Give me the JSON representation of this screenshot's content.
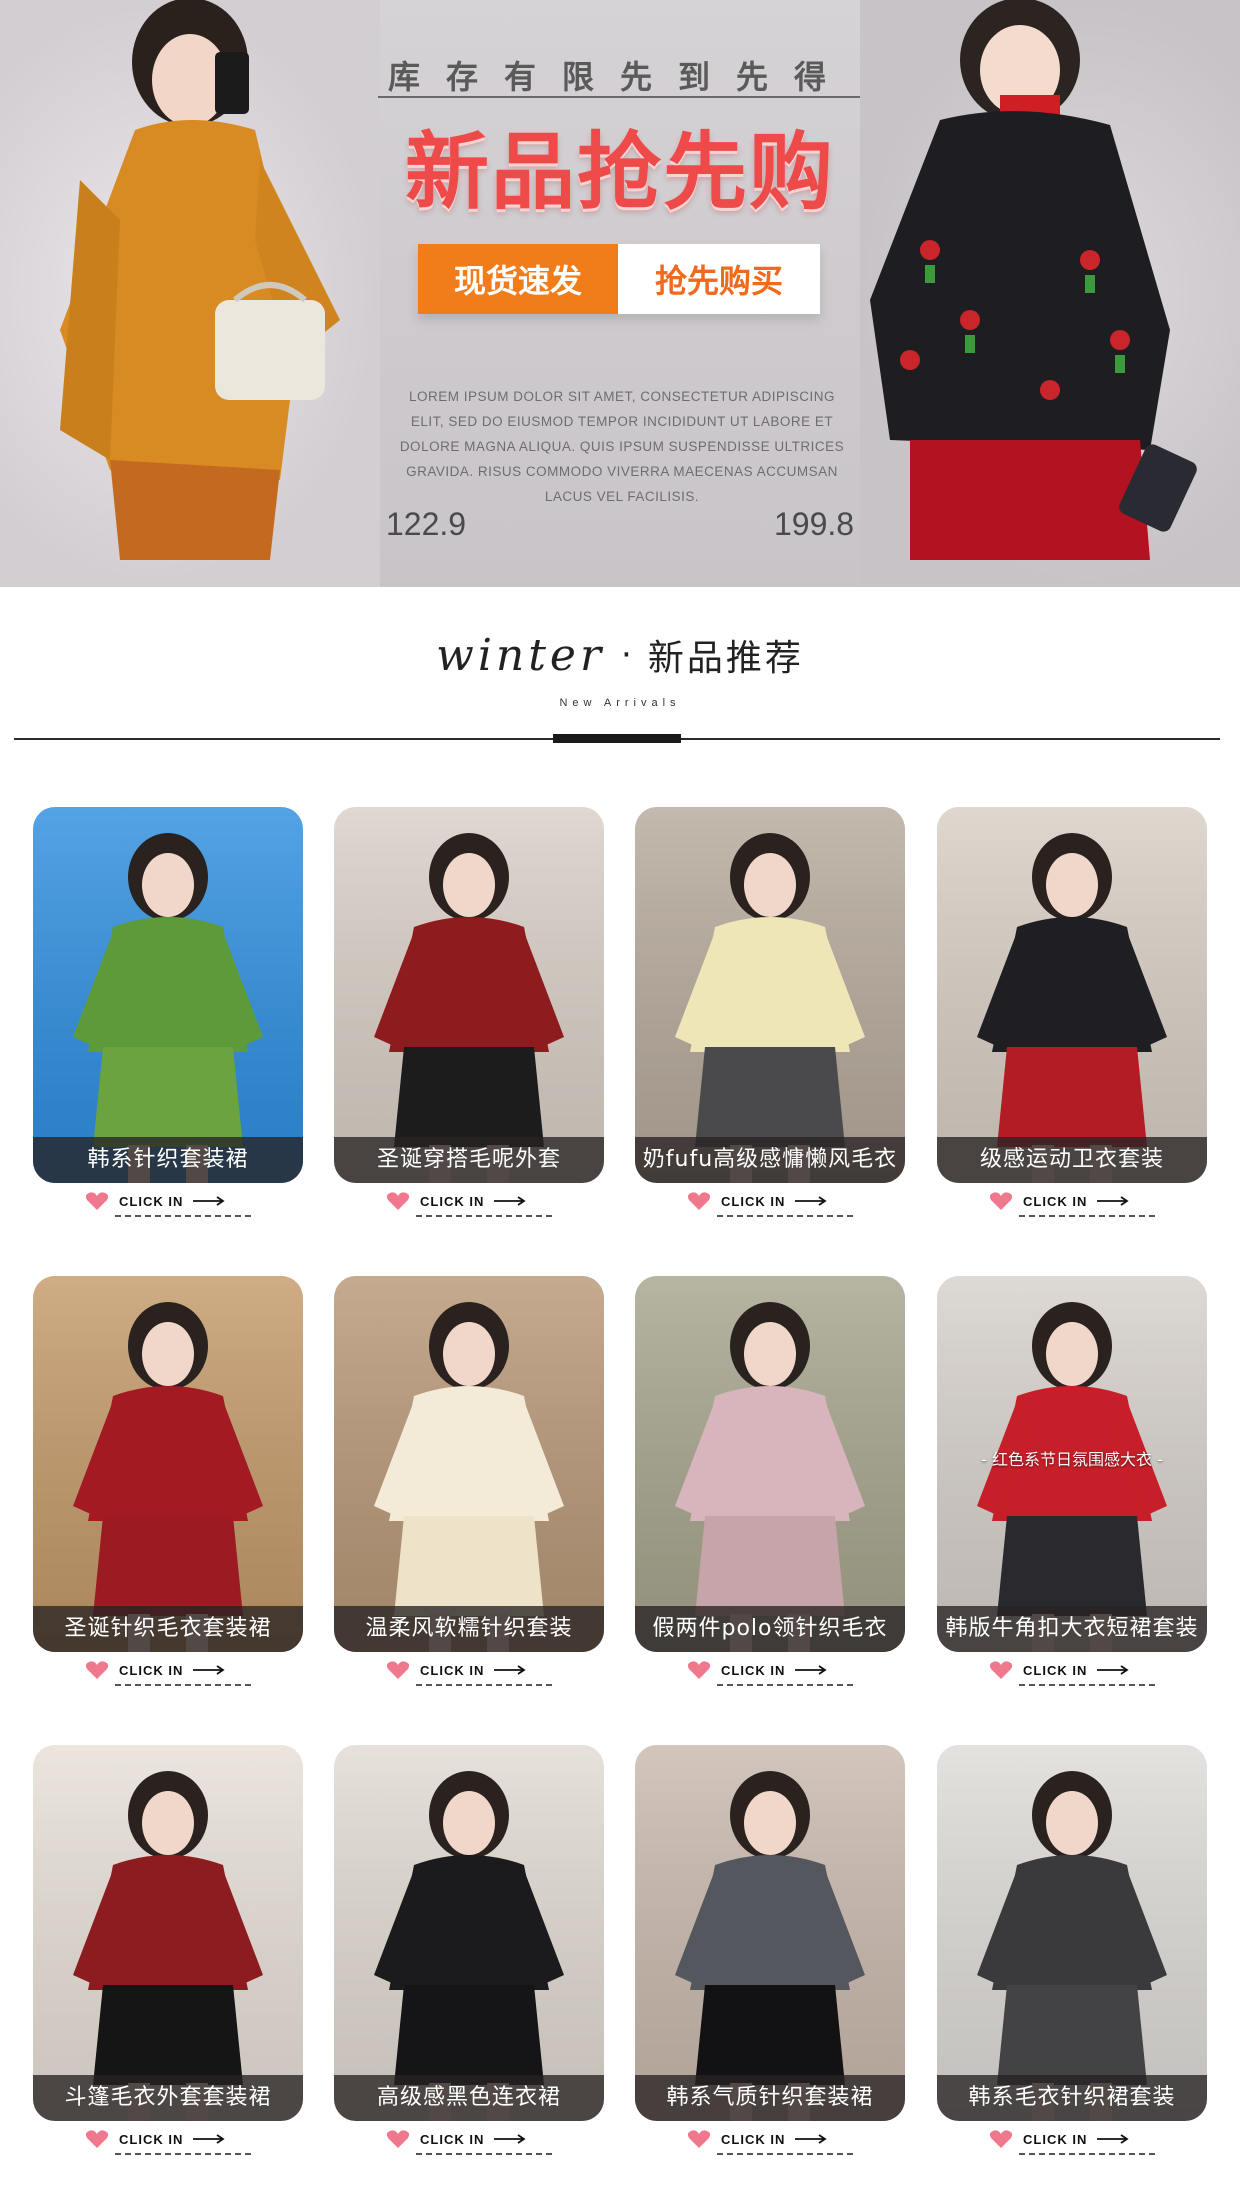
{
  "hero": {
    "subtitle": "库存有限先到先得",
    "title": "新品抢先购",
    "btn_left": "现货速发",
    "btn_right": "抢先购买",
    "lorem": "LOREM IPSUM DOLOR SIT AMET, CONSECTETUR ADIPISCING ELIT, SED DO EIUSMOD TEMPOR INCIDIDUNT UT LABORE ET DOLORE MAGNA ALIQUA. QUIS IPSUM SUSPENDISSE ULTRICES GRAVIDA. RISUS COMMODO VIVERRA MAECENAS ACCUMSAN LACUS VEL FACILISIS.",
    "price_left": "122.9",
    "price_right": "199.8"
  },
  "section": {
    "title_en": "winter",
    "title_sep": "·",
    "title_cn": "新品推荐",
    "subtitle": "New Arrivals"
  },
  "click_text": "CLICK IN",
  "products": [
    {
      "label": "韩系针织套装裙",
      "bg": "#2f8fe0",
      "top": "#5d9a3a",
      "bottom": "#6aa33f"
    },
    {
      "label": "圣诞穿搭毛呢外套",
      "bg": "#d9cfc6",
      "top": "#8e1b1e",
      "bottom": "#1c1c1c"
    },
    {
      "label": "奶fufu高级感慵懒风毛衣",
      "bg": "#b7aa9c",
      "top": "#efe6b8",
      "bottom": "#4a4a4d"
    },
    {
      "label": "级感运动卫衣套装",
      "bg": "#d8cfc4",
      "top": "#1f1f23",
      "bottom": "#b41c25"
    },
    {
      "label": "圣诞针织毛衣套装裙",
      "bg": "#c49a6a",
      "top": "#a31a22",
      "bottom": "#9c1a21"
    },
    {
      "label": "温柔风软糯针织套装",
      "bg": "#b89878",
      "top": "#f3ead7",
      "bottom": "#eee2c9"
    },
    {
      "label": "假两件polo领针织毛衣",
      "bg": "#a7a58d",
      "top": "#d8b5bc",
      "bottom": "#c7a3aa"
    },
    {
      "label": "韩版牛角扣大衣短裙套装",
      "bg": "#d7d1cb",
      "top": "#c71f29",
      "bottom": "#2a2a2e",
      "tag": "- 红色系节日氛围感大衣 -"
    },
    {
      "label": "斗篷毛衣外套套装裙",
      "bg": "#e7e0d7",
      "top": "#8c1c1f",
      "bottom": "#151515"
    },
    {
      "label": "高级感黑色连衣裙",
      "bg": "#e1dad2",
      "top": "#1b1b1d",
      "bottom": "#151517"
    },
    {
      "label": "韩系气质针织套装裙",
      "bg": "#c9b9ad",
      "top": "#55575e",
      "bottom": "#121214"
    },
    {
      "label": "韩系毛衣针织裙套装",
      "bg": "#dedbd8",
      "top": "#3a3a3c",
      "bottom": "#434345"
    }
  ],
  "colors": {
    "accent_red": "#ee4a4a",
    "accent_orange": "#f07c1a",
    "heart_pink": "#f0788c"
  }
}
